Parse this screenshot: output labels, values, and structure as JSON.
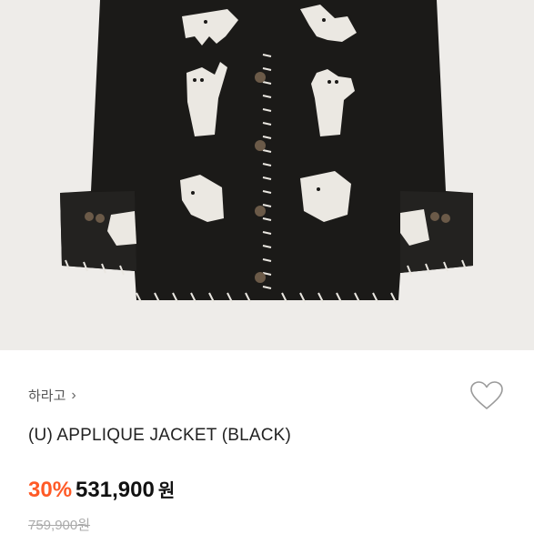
{
  "product": {
    "image_alt": "Black wool jacket with white animal and figure appliqués",
    "brand": "하라고",
    "brand_chevron_icon": "chevron-right-icon",
    "wishlist_icon": "heart-outline-icon",
    "title": "(U) APPLIQUE JACKET (BLACK)",
    "discount": "30%",
    "price": "531,900",
    "currency": "원",
    "original_price": "759,900원"
  },
  "colors": {
    "discount": "#ff5a26",
    "jacket": "#1b1a18",
    "background": "#eeece9"
  }
}
